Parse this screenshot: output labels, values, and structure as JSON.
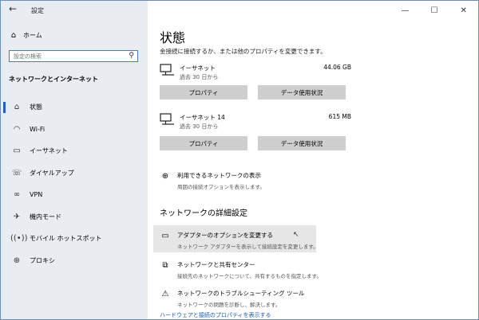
{
  "window": {
    "title": "設定",
    "controls": {
      "minimize": "—",
      "maximize": "☐",
      "close": "✕"
    }
  },
  "sidebar": {
    "home_label": "ホーム",
    "search_placeholder": "設定の検索",
    "section_title": "ネットワークとインターネット",
    "items": [
      {
        "label": "状態",
        "icon": "home-icon"
      },
      {
        "label": "Wi-Fi",
        "icon": "wifi-icon"
      },
      {
        "label": "イーサネット",
        "icon": "ethernet-icon"
      },
      {
        "label": "ダイヤルアップ",
        "icon": "dialup-icon"
      },
      {
        "label": "VPN",
        "icon": "vpn-icon"
      },
      {
        "label": "機内モード",
        "icon": "airplane-icon"
      },
      {
        "label": "モバイル ホットスポット",
        "icon": "hotspot-icon"
      },
      {
        "label": "プロキシ",
        "icon": "globe-icon"
      }
    ]
  },
  "main": {
    "title": "状態",
    "subtitle": "金接続に接続するか、または他のプロパティを変更できます。",
    "connections": [
      {
        "name": "イーサネット",
        "period": "過去 30 日から",
        "size": "44.06 GB",
        "props_label": "プロパティ",
        "usage_label": "データ使用状況"
      },
      {
        "name": "イーサネット 14",
        "period": "過去 30 日から",
        "size": "615 MB",
        "props_label": "プロパティ",
        "usage_label": "データ使用状況"
      }
    ],
    "available_networks": {
      "title": "利用できるネットワークの表示",
      "desc": "周囲の接続オプションを表示します。"
    },
    "advanced_title": "ネットワークの詳細設定",
    "advanced": [
      {
        "title": "アダプターのオプションを変更する",
        "desc": "ネットワーク アダプターを表示して接続設定を変更します。"
      },
      {
        "title": "ネットワークと共有センター",
        "desc": "接続先のネットワークについて、共有するものを指定します。"
      },
      {
        "title": "ネットワークのトラブルシューティング ツール",
        "desc": "ネットワークの問題を診断し、解決します。"
      }
    ],
    "bottom_link": "ハードウェアと接続のプロパティを表示する"
  }
}
